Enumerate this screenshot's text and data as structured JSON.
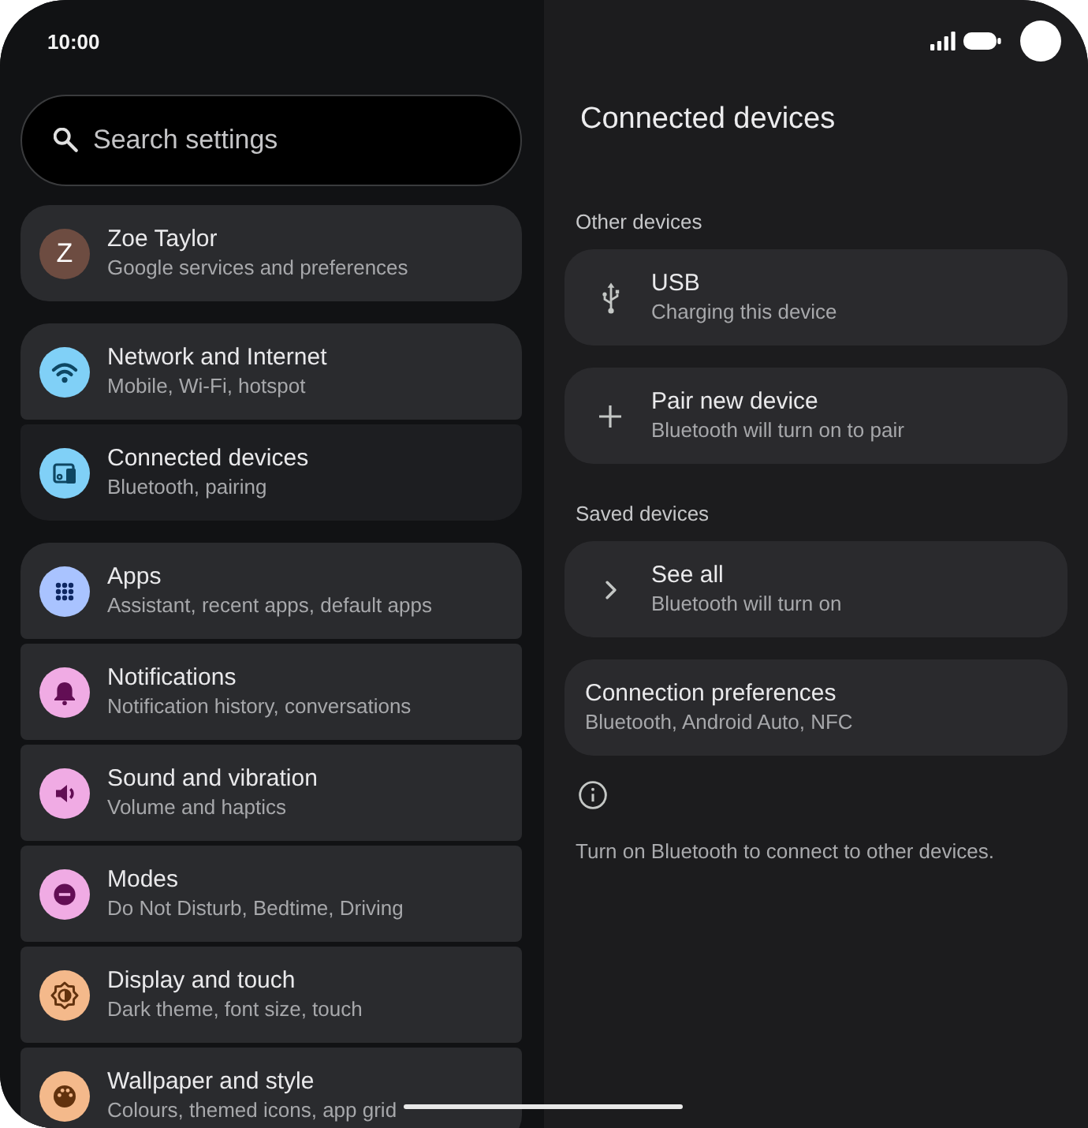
{
  "status_bar": {
    "time": "10:00"
  },
  "search": {
    "placeholder": "Search settings"
  },
  "settings_groups": [
    {
      "items": [
        {
          "kind": "account",
          "title": "Zoe Taylor",
          "subtitle": "Google services and preferences",
          "avatar_letter": "Z",
          "color": "#6d4c41",
          "selected": false
        }
      ]
    },
    {
      "items": [
        {
          "kind": "category",
          "title": "Network and Internet",
          "subtitle": "Mobile, Wi-Fi, hotspot",
          "color": "#80d0f7",
          "selected": false
        },
        {
          "kind": "category",
          "title": "Connected devices",
          "subtitle": "Bluetooth, pairing",
          "color": "#80d0f7",
          "selected": true
        }
      ]
    },
    {
      "items": [
        {
          "kind": "category",
          "title": "Apps",
          "subtitle": "Assistant, recent apps, default apps",
          "color": "#a9c3ff",
          "selected": false
        },
        {
          "kind": "category",
          "title": "Notifications",
          "subtitle": "Notification history, conversations",
          "color": "#f0abe4",
          "selected": false
        },
        {
          "kind": "category",
          "title": "Sound and vibration",
          "subtitle": "Volume and haptics",
          "color": "#f0abe4",
          "selected": false
        },
        {
          "kind": "category",
          "title": "Modes",
          "subtitle": "Do Not Disturb, Bedtime, Driving",
          "color": "#f0abe4",
          "selected": false
        },
        {
          "kind": "category",
          "title": "Display and touch",
          "subtitle": "Dark theme, font size, touch",
          "color": "#f4b98b",
          "selected": false
        },
        {
          "kind": "category",
          "title": "Wallpaper and style",
          "subtitle": "Colours, themed icons, app grid",
          "color": "#f4b98b",
          "selected": false
        }
      ]
    }
  ],
  "detail": {
    "title": "Connected devices",
    "sections": [
      {
        "label": "Other devices",
        "items": [
          {
            "kind": "icon",
            "title": "USB",
            "subtitle": "Charging this device"
          },
          {
            "kind": "icon",
            "title": "Pair new device",
            "subtitle": "Bluetooth will turn on to pair"
          }
        ]
      },
      {
        "label": "Saved devices",
        "items": [
          {
            "kind": "icon",
            "title": "See all",
            "subtitle": "Bluetooth will turn on"
          }
        ]
      },
      {
        "items": [
          {
            "kind": "plain",
            "title": "Connection preferences",
            "subtitle": "Bluetooth, Android Auto, NFC"
          }
        ]
      }
    ],
    "footer": {
      "text": "Turn on Bluetooth to connect to other devices."
    }
  }
}
